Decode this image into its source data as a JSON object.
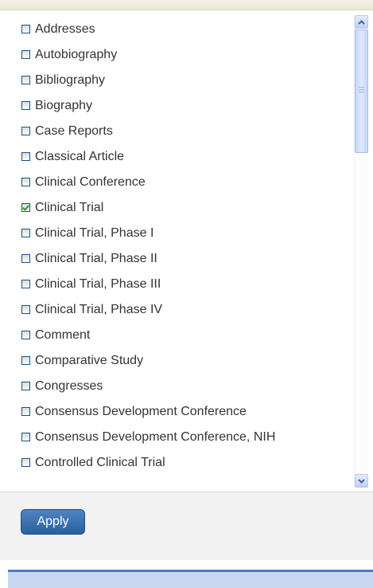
{
  "filter_list": {
    "items": [
      {
        "label": "Addresses",
        "checked": false
      },
      {
        "label": "Autobiography",
        "checked": false
      },
      {
        "label": "Bibliography",
        "checked": false
      },
      {
        "label": "Biography",
        "checked": false
      },
      {
        "label": "Case Reports",
        "checked": false
      },
      {
        "label": "Classical Article",
        "checked": false
      },
      {
        "label": "Clinical Conference",
        "checked": false
      },
      {
        "label": "Clinical Trial",
        "checked": true
      },
      {
        "label": "Clinical Trial, Phase I",
        "checked": false
      },
      {
        "label": "Clinical Trial, Phase II",
        "checked": false
      },
      {
        "label": "Clinical Trial, Phase III",
        "checked": false
      },
      {
        "label": "Clinical Trial, Phase IV",
        "checked": false
      },
      {
        "label": "Comment",
        "checked": false
      },
      {
        "label": "Comparative Study",
        "checked": false
      },
      {
        "label": "Congresses",
        "checked": false
      },
      {
        "label": "Consensus Development Conference",
        "checked": false
      },
      {
        "label": "Consensus Development Conference, NIH",
        "checked": false
      },
      {
        "label": "Controlled Clinical Trial",
        "checked": false
      }
    ]
  },
  "footer": {
    "apply_label": "Apply"
  },
  "colors": {
    "button_top": "#4f84c1",
    "button_bottom": "#2b5f9f",
    "checkmark": "#21a121",
    "text": "#333333"
  }
}
